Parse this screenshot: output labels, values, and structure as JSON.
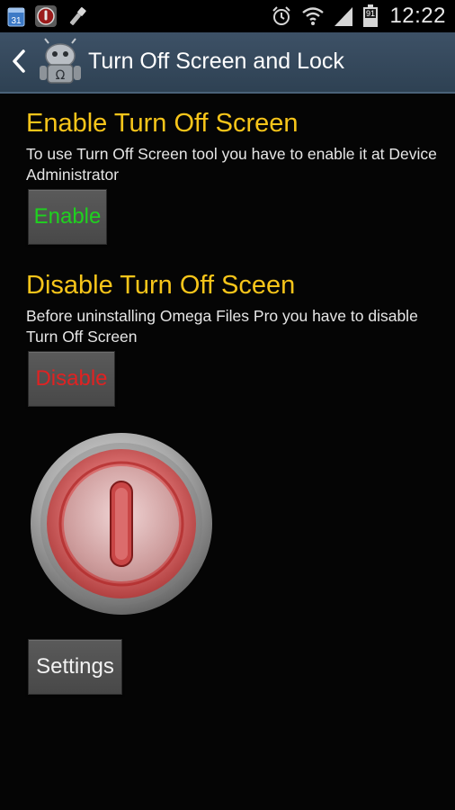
{
  "status_bar": {
    "time": "12:22",
    "battery_level": "91",
    "icons": [
      "calendar-icon",
      "app-notification-icon",
      "flashlight-icon",
      "alarm-icon",
      "wifi-icon",
      "signal-icon",
      "battery-icon"
    ]
  },
  "action_bar": {
    "title": "Turn Off Screen and Lock",
    "back_icon": "chevron-left-icon",
    "logo_icon": "omega-robot-logo"
  },
  "enable_section": {
    "title": "Enable Turn Off Screen",
    "description": "To use Turn Off Screen tool you have to enable it at Device Administrator",
    "button_label": "Enable"
  },
  "disable_section": {
    "title": "Disable Turn Off Sceen",
    "description": "Before uninstalling Omega Files Pro you have to disable Turn Off Screen",
    "button_label": "Disable"
  },
  "power_button": {
    "icon": "power-icon"
  },
  "settings_button": {
    "label": "Settings"
  },
  "colors": {
    "accent_title": "#f7c51a",
    "enable_green": "#1fd21f",
    "disable_red": "#e02222",
    "action_bar": "#34495c",
    "background": "#050505"
  }
}
